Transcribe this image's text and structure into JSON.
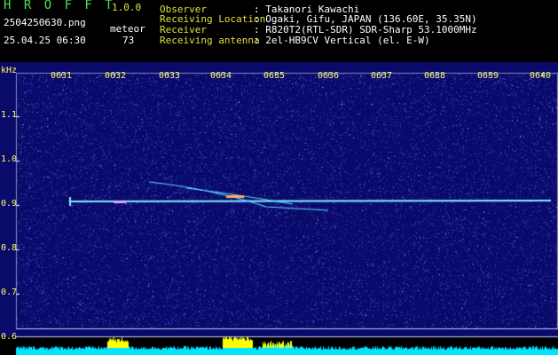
{
  "header": {
    "app_name": "H R O F F T",
    "version": "1.0.0",
    "filename": "2504250630.png",
    "datetime": "25.04.25 06:30",
    "counter_label": "meteor",
    "counter_value": "73",
    "info": [
      {
        "key": "Observer",
        "value": ": Takanori Kawachi"
      },
      {
        "key": "Receiving Location",
        "value": ": Ogaki, Gifu, JAPAN (136.60E, 35.35N)"
      },
      {
        "key": "Receiver",
        "value": ": R820T2(RTL-SDR) SDR-Sharp 53.1000MHz"
      },
      {
        "key": "Receiving antenna",
        "value": ": 2el-HB9CV Vertical (el. E-W)"
      }
    ]
  },
  "axis": {
    "unit": "kHz",
    "y_ticks": [
      "1.1",
      "1.0",
      "0.9",
      "0.8",
      "0.7",
      "0.6"
    ],
    "x_ticks": [
      "0631",
      "0632",
      "0633",
      "0634",
      "0635",
      "0636",
      "0637",
      "0638",
      "0639",
      "0640"
    ]
  },
  "colors": {
    "background": "#0a0a6a",
    "noise": "#3a46c8",
    "carrier": "#7ff0ff",
    "power_bar": "#00e5ff",
    "power_peak": "#ffff00",
    "label": "#e0e040"
  }
}
